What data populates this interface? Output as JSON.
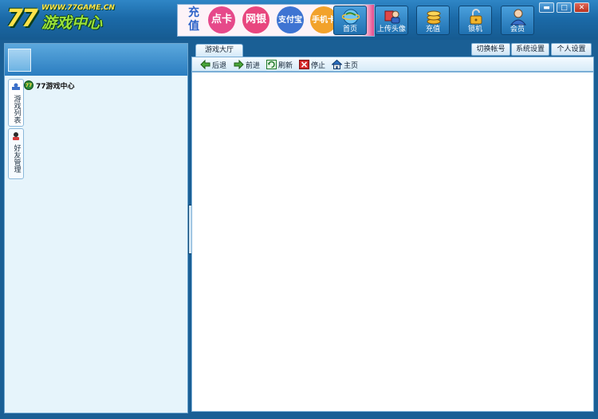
{
  "logo": {
    "number": "77",
    "chinese": "游戏中心",
    "url": "WWW.77GAME.CN"
  },
  "banner": {
    "first": "充值",
    "circles": [
      "点卡",
      "网银",
      "支付宝",
      "手机卡"
    ]
  },
  "toolbar": {
    "home": "首页",
    "upload_photo": "上传头像",
    "recharge": "充值",
    "lock": "锁机",
    "member": "会员"
  },
  "window_controls": {
    "minimize": "▬",
    "maximize": "□",
    "close": "✕"
  },
  "sidebar": {
    "tabs": [
      "游戏列表",
      "好友管理"
    ],
    "tree": [
      {
        "label": "77游戏中心"
      }
    ]
  },
  "main": {
    "tab": "游戏大厅",
    "top_buttons": [
      "切换帐号",
      "系统设置",
      "个人设置"
    ],
    "nav": {
      "back": "后退",
      "forward": "前进",
      "refresh": "刷新",
      "stop": "停止",
      "home": "主页"
    }
  },
  "colors": {
    "titlebar": "#1b6aa8",
    "panel_bg": "#e6f4fb",
    "content_bg": "#ffffff"
  }
}
